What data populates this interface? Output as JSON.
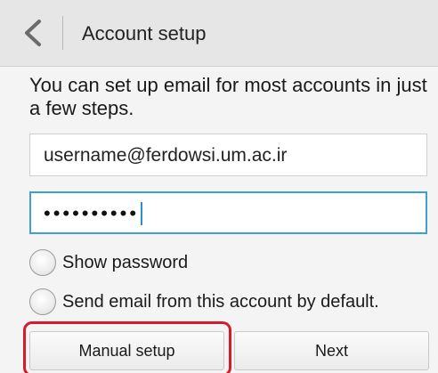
{
  "action_bar": {
    "back_icon": "chevron-left-icon",
    "title": "Account setup"
  },
  "intro_text": "You can set up email for most accounts in just a few steps.",
  "email_field": {
    "value": "username@ferdowsi.um.ac.ir"
  },
  "password_field": {
    "masked_value": "••••••••••"
  },
  "options": {
    "show_password": {
      "label": "Show password",
      "checked": false
    },
    "default_account": {
      "label": "Send email from this account by default.",
      "checked": false
    }
  },
  "buttons": {
    "manual_setup": "Manual setup",
    "next": "Next"
  },
  "colors": {
    "focus_border": "#3d9fd6",
    "highlight_outline": "#d51c2a",
    "action_bar_bg": "#e6e6e6"
  }
}
